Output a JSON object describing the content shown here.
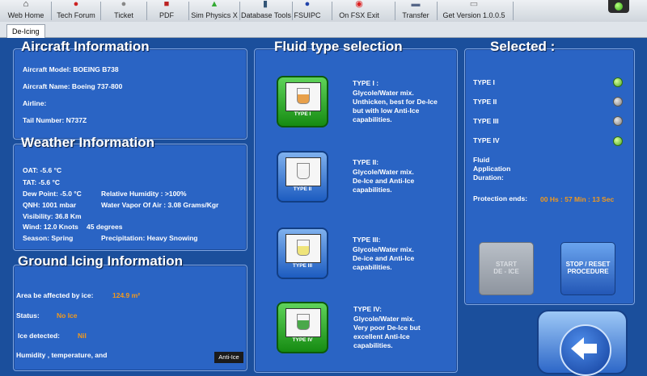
{
  "toolbar": {
    "items": [
      {
        "label": "Web Home",
        "icon": "home-icon"
      },
      {
        "label": "Tech Forum",
        "icon": "forum-icon"
      },
      {
        "label": "Ticket",
        "icon": "ticket-icon"
      },
      {
        "label": "PDF",
        "icon": "pdf-icon"
      },
      {
        "label": "Sim Physics X",
        "icon": "physics-icon"
      },
      {
        "label": "Database Tools",
        "icon": "database-icon"
      },
      {
        "label": "FSUIPC",
        "icon": "fsuipc-icon"
      },
      {
        "label": "On FSX Exit",
        "icon": "exit-icon"
      },
      {
        "label": "Transfer",
        "icon": "transfer-icon"
      },
      {
        "label": "Get Version 1.0.0.5",
        "icon": "version-icon"
      }
    ]
  },
  "tab": {
    "label": "De-Icing"
  },
  "aircraft": {
    "title": "Aircraft Information",
    "model": "Aircraft Model: BOEING B738",
    "name": "Aircraft Name: Boeing 737-800",
    "airline": "Airline:",
    "tail": "Tail Number: N737Z"
  },
  "weather": {
    "title": "Weather Information",
    "oat": "OAT: -5.6 °C",
    "tat": "TAT: -5.6 °C",
    "dew": "Dew Point: -5.0 °C",
    "humidity": "Relative Humidity : >100%",
    "qnh": "QNH: 1001 mbar",
    "vapor": "Water Vapor Of Air : 3.08 Grams/Kgr",
    "visibility": "Visibility: 36.8 Km",
    "wind": "Wind: 12.0 Knots",
    "wind_dir": "45 degrees",
    "season": "Season: Spring",
    "precip": "Precipitation: Heavy Snowing"
  },
  "ground": {
    "title": "Ground Icing Information",
    "area_label": "Area be affected by ice:",
    "area_value": "124.9 m²",
    "status_label": "Status:",
    "status_value": "No Ice",
    "detected_label": "Ice detected:",
    "detected_value": "Nil",
    "humidity_line1": "Humidity , temperature, and",
    "anti_ice": "Anti-Ice"
  },
  "fluid": {
    "title": "Fluid type selection",
    "types": [
      {
        "caption": "TYPE I",
        "label": "TYPE I :",
        "desc": [
          "Glycole/Water mix.",
          "Unthicken, best for De-Ice",
          "but with low Anti-Ice",
          "capabilities."
        ],
        "liquid": "#e8a04a"
      },
      {
        "caption": "TYPE II",
        "label": "TYPE II:",
        "desc": [
          "Glycole/Water mix.",
          "De-Ice and Anti-Ice",
          "capabilities."
        ],
        "liquid": "#f2f2f2"
      },
      {
        "caption": "TYPE III",
        "label": "TYPE III:",
        "desc": [
          "Glycole/Water mix.",
          "De-ice and Anti-Ice",
          "capabilities."
        ],
        "liquid": "#efe47a"
      },
      {
        "caption": "TYPE IV",
        "label": "TYPE IV:",
        "desc": [
          "Glycole/Water mix.",
          "Very poor De-Ice but",
          "excellent Anti-Ice",
          "capabilities."
        ],
        "liquid": "#4aa84a"
      }
    ]
  },
  "selected": {
    "title": "Selected :",
    "types": [
      {
        "label": "TYPE I",
        "on": true
      },
      {
        "label": "TYPE II",
        "on": false
      },
      {
        "label": "TYPE III",
        "on": false
      },
      {
        "label": "TYPE IV",
        "on": true
      }
    ],
    "fluid_label": [
      "Fluid",
      "Application",
      "Duration:"
    ],
    "protection_label": "Protection ends:",
    "protection_value": "00 Hs : 57 Min : 13 Sec",
    "start_button": [
      "START",
      "DE - ICE"
    ],
    "stop_button": [
      "STOP / RESET",
      "PROCEDURE"
    ]
  },
  "colors": {
    "accent_orange": "#f39a1c",
    "panel_blue": "#2a64c4",
    "background_blue": "#1b4f9c"
  }
}
